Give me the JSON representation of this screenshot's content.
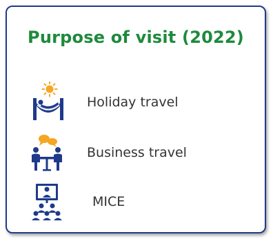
{
  "panel": {
    "title": "Purpose of visit (2022)",
    "items": [
      {
        "label": "Holiday travel",
        "icon": "hammock-sun-icon"
      },
      {
        "label": "Business travel",
        "icon": "business-meeting-icon"
      },
      {
        "label": "MICE",
        "icon": "conference-presentation-icon"
      }
    ]
  },
  "colors": {
    "title": "#1e8a3c",
    "border": "#1f3a8a",
    "icon_primary": "#1e3a8a",
    "icon_accent": "#f5a623",
    "text": "#333333"
  }
}
